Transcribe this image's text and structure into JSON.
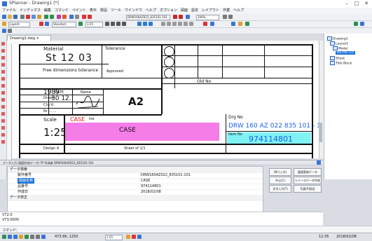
{
  "window": {
    "title": "SPlanner - Drawing1 [*]",
    "buttons": [
      "–",
      "□",
      "✕"
    ]
  },
  "menu": [
    "ファイル",
    "インデックス",
    "編集",
    "コマンド",
    "ペイント",
    "表示",
    "部品",
    "ツール",
    "ウインドウ",
    "ヘルプ",
    "オプション",
    "図面",
    "設定",
    "レイアウト",
    "作業",
    "ヘルプ"
  ],
  "toolbar": {
    "layer_field": "Layer0",
    "style_field": "Standard",
    "scale_field": "1:25",
    "file_field": "DRW160AZ022_835101-101",
    "zoom_field": "100%"
  },
  "doc_tab": {
    "label": "Drawing1.dwg ×"
  },
  "drawing": {
    "material_label": "Material",
    "material_value": "St 12  03",
    "tolerance_label": "Tolerance",
    "free_dimensions": "Free dimensions  tolerance",
    "approved": "Approved",
    "old_no": "Old No",
    "year": "1989",
    "date_label": "DATE",
    "name_label": "Name",
    "drawn_label": "Drawn",
    "drawn_date": "30 12.",
    "checked_label": "Chk'd",
    "norm_label": "Nr  ...  ...  ",
    "size": "A2",
    "scale_label": "Scale",
    "scale_value": "1:25",
    "case_label": "CASE",
    "case_small": "ine",
    "case_field": "CASE",
    "drg_no_label": "Drg No",
    "drg_no_value": "DRW 160 AZ 022  835 101 - 101",
    "item_no_label": "Item No",
    "item_no_value": "974114801",
    "design_label": "Design  A",
    "sheet_label": "Sheet  of  1/1"
  },
  "right_panel": {
    "tree": [
      "Drawing1",
      "Layout1",
      "Model",
      "DETAIL-1/1",
      "Sheet",
      "Title Block"
    ]
  },
  "properties": {
    "header": "データ入力 (図面作成データ) FP 作成者 DRW160AZ022_835101-101",
    "rows": [
      {
        "key": "データ検索",
        "value": "",
        "group": true
      },
      {
        "key": "製作番号",
        "value": "DRW160AZ022_835101-101",
        "group": false
      },
      {
        "key": "図面名称",
        "value": "CASE",
        "group": false,
        "selected": true
      },
      {
        "key": "品番号",
        "value": "974114801",
        "group": false
      },
      {
        "key": "作成日",
        "value": "2018/02/08",
        "group": false
      },
      {
        "key": "データ修正",
        "value": "",
        "group": true
      }
    ],
    "buttons": [
      "OK (入力)",
      "図面登録データ",
      "中止(C)",
      "シリーズデータ作成",
      "文字入力(T)",
      "写真(P)設定"
    ],
    "lower_lines": [
      "V72.0",
      "V73.0000"
    ]
  },
  "command": {
    "prompt": "コマンド:"
  },
  "status": {
    "coords": "473.96, 1250",
    "mode_field": "1:25",
    "time": "12:35",
    "date": "2018/02/08"
  },
  "colors": {
    "case_fill": "#f57de8",
    "item_fill": "#7ff3f4",
    "drg_text": "#1b5ee8",
    "selection": "#1e73d8",
    "case_red": "#e8181b"
  }
}
